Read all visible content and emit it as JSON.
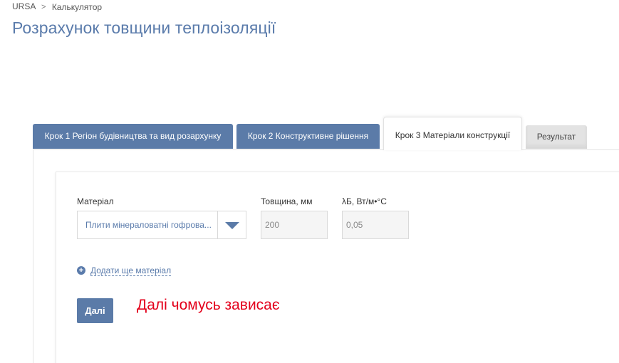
{
  "breadcrumb": {
    "home": "URSA",
    "separator": ">",
    "current": "Калькулятор"
  },
  "page_title": "Розрахунок товщини теплоізоляції",
  "tabs": [
    {
      "label": "Крок 1 Регіон будівництва та вид розархунку",
      "active": false
    },
    {
      "label": "Крок 2 Конструктивне рішення",
      "active": false
    },
    {
      "label": "Крок 3 Матеріали конструкції",
      "active": true
    },
    {
      "label": "Результат",
      "active": false
    }
  ],
  "form": {
    "material_label": "Матеріал",
    "material_value": "Плити мінераловатні гофрова...",
    "thickness_label": "Товщина, мм",
    "thickness_value": "200",
    "lambda_label": "λБ, Вт/м•°С",
    "lambda_value": "0,05",
    "add_material_label": "Додати ще матеріал",
    "next_button": "Далі"
  },
  "annotation": "Далі чомусь зависає",
  "colors": {
    "accent": "#5b7ba8",
    "title": "#5a7bab",
    "annotation": "#e3001b"
  },
  "icons": {
    "select_arrow": "chevron-down-icon",
    "add": "plus-circle-icon"
  }
}
